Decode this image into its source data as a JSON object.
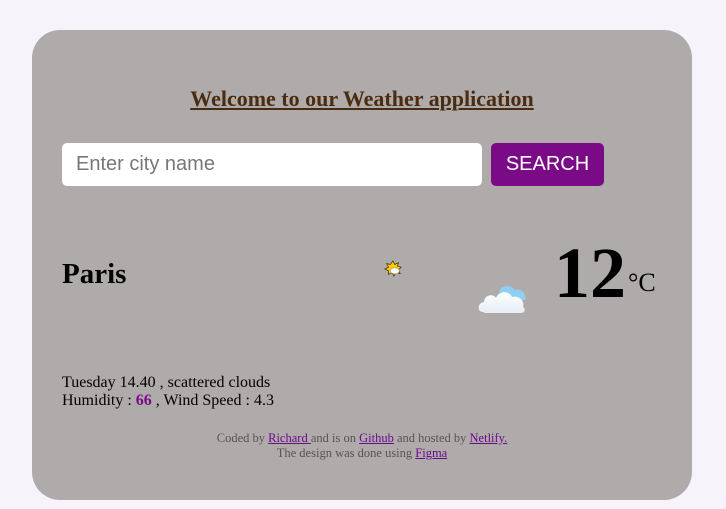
{
  "header": {
    "title": "Welcome to our Weather application"
  },
  "search": {
    "placeholder": "Enter city name",
    "value": "",
    "button_label": "SEARCH"
  },
  "weather": {
    "city": "Paris",
    "temperature": "12",
    "unit": "°C",
    "day_time": "Tuesday 14.40",
    "description": "scattered clouds",
    "humidity_label": "Humidity :",
    "humidity_value": "66",
    "wind_label": ", Wind Speed :",
    "wind_value": "4.3",
    "icons": [
      "partly-sunny-icon",
      "cloud-icon"
    ]
  },
  "footer": {
    "coded_by": "Coded by",
    "author_link": "Richard",
    "and_is_on": "and is on",
    "github_link": "Github",
    "hosted_by": "and hosted by",
    "netlify_link": "Netlify.",
    "design_text": "The design was done using",
    "figma_link": "Figma"
  },
  "colors": {
    "card_background": "#b0abab",
    "accent": "#7b0a86",
    "title": "#4a2c12"
  }
}
